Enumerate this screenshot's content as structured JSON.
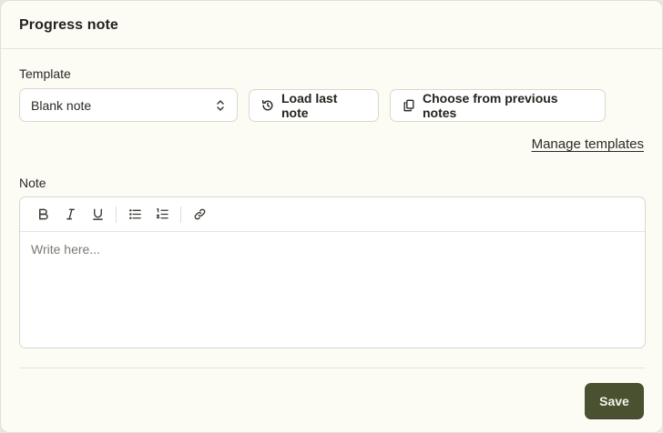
{
  "header": {
    "title": "Progress note"
  },
  "template": {
    "label": "Template",
    "select_value": "Blank note",
    "load_last_label": "Load last note",
    "choose_previous_label": "Choose from previous notes",
    "manage_link": "Manage templates"
  },
  "note": {
    "label": "Note",
    "placeholder": "Write here...",
    "toolbar": [
      "bold-icon",
      "italic-icon",
      "underline-icon",
      "bullet-list-icon",
      "numbered-list-icon",
      "link-icon"
    ]
  },
  "footer": {
    "save_label": "Save"
  },
  "colors": {
    "background": "#fcfcf4",
    "primary_button": "#4a5131",
    "border": "#d9d8cd"
  }
}
